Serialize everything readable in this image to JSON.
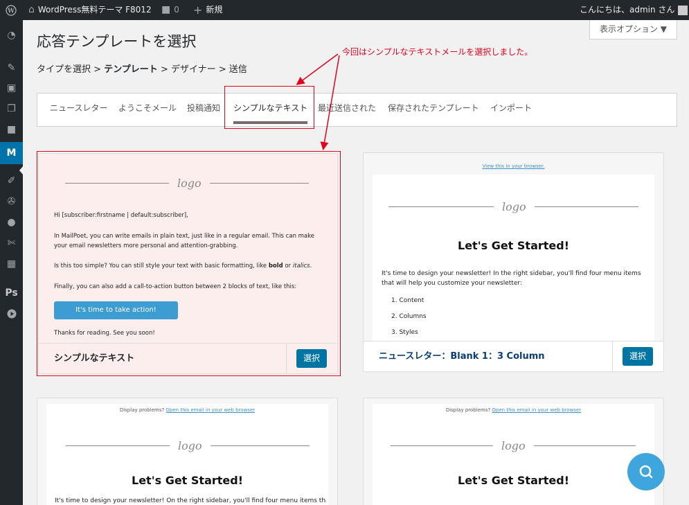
{
  "adminbar": {
    "site_name": "WordPress無料テーマ F8012",
    "comments_count": "0",
    "new_label": "新規",
    "greeting": "こんにちは、admin さん"
  },
  "screen_options": "表示オプション ▼",
  "page_title": "応答テンプレートを選択",
  "breadcrumb": {
    "step1": "タイプを選択",
    "sep1": " > ",
    "step2": "テンプレート",
    "sep2": " > ",
    "step3": "デザイナー",
    "sep3": " > ",
    "step4": "送信"
  },
  "tabs": [
    {
      "label": "ニュースレター"
    },
    {
      "label": "ようこそメール"
    },
    {
      "label": "投稿通知"
    },
    {
      "label": "シンプルなテキスト"
    },
    {
      "label": "最近送信された"
    },
    {
      "label": "保存されたテンプレート"
    },
    {
      "label": "インポート"
    }
  ],
  "annotation": "今回はシンプルなテキストメールを選択しました。",
  "cards": [
    {
      "name": "シンプルなテキスト",
      "select_label": "選択",
      "logo": "logo",
      "paragraphs": [
        "Hi [subscriber:firstname | default:subscriber],",
        "In MailPoet, you can write emails in plain text, just like in a regular email. This can make your email newsletters more personal and attention-grabbing.",
        "Is this too simple? You can still style your text with basic formatting, like bold or italics.",
        "Finally, you can also add a call-to-action button between 2 blocks of text, like this:"
      ],
      "p3_before": "Is this too simple? You can still style your text with basic formatting, like ",
      "p3_bold": "bold",
      "p3_mid": " or ",
      "p3_italic": "italics",
      "p3_end": ".",
      "cta": "It's time to take action!",
      "closing": "Thanks for reading. See you soon!"
    },
    {
      "name": "ニュースレター：Blank 1：3 Column",
      "select_label": "選択",
      "view_link": "View this in your browser.",
      "logo": "logo",
      "heading": "Let's Get Started!",
      "body": "It's time to design your newsletter! In the right sidebar, you'll find four menu items that will help you customize your newsletter:",
      "list": [
        "1.  Content",
        "2.  Columns",
        "3.  Styles"
      ]
    },
    {
      "display_problems": "Display problems? ",
      "display_link": "Open this email in your web browser",
      "logo": "logo",
      "heading": "Let's Get Started!",
      "body": "It's time to design your newsletter! On the right sidebar, you'll find four menu items that"
    },
    {
      "display_problems": "Display problems? ",
      "display_link": "Open this email in your web browser",
      "logo": "logo",
      "heading": "Let's Get Started!"
    }
  ],
  "icons": [
    "wordpress-icon",
    "home-icon",
    "comment-icon",
    "plus-icon",
    "avatar",
    "dashboard-icon",
    "pin-icon",
    "media-icon",
    "pages-icon",
    "comments-icon",
    "mailpoet-icon",
    "appearance-icon",
    "plugins-icon",
    "users-icon",
    "tools-icon",
    "settings-icon",
    "ps-icon",
    "play-icon",
    "search-icon"
  ],
  "colors": {
    "accent": "#0073aa",
    "annotation": "#e3001b",
    "fab": "#3ea5dd"
  }
}
